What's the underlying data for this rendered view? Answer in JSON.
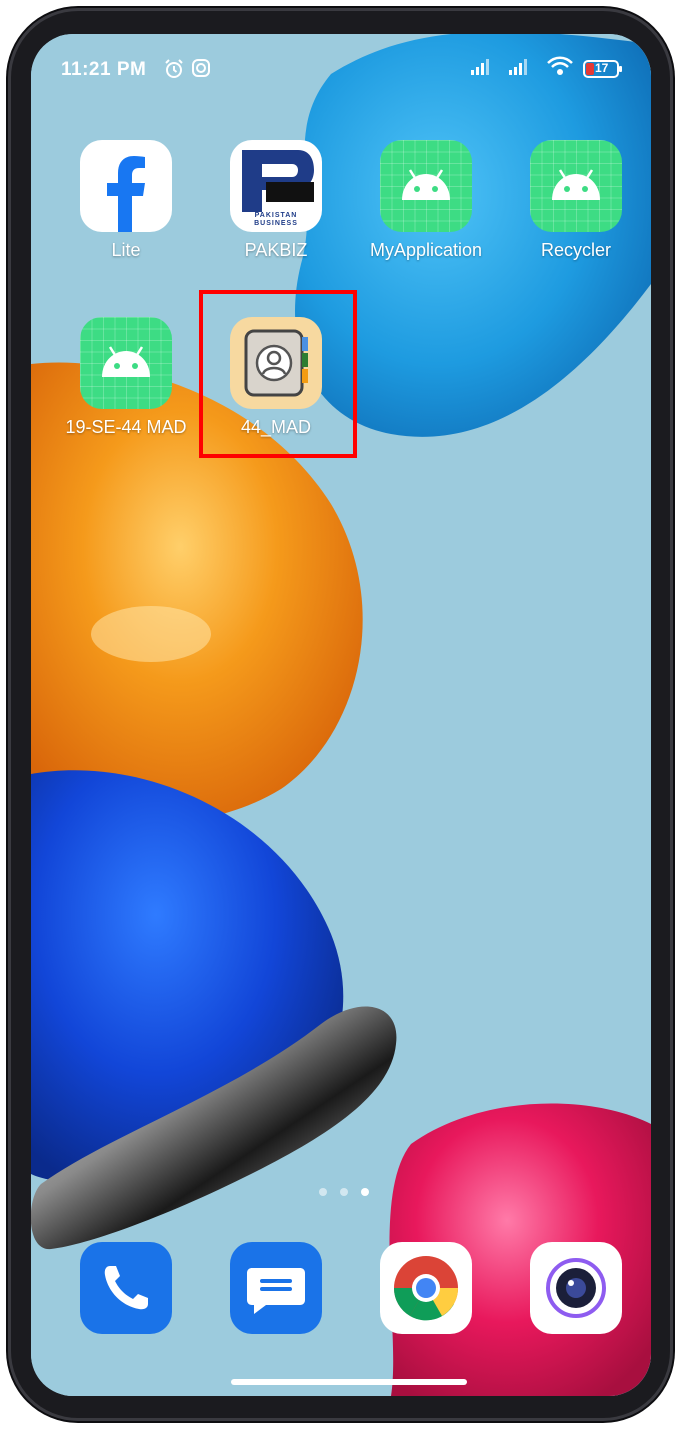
{
  "status_bar": {
    "time": "11:21 PM",
    "battery": "17",
    "icons": [
      "alarm-icon",
      "instagram-icon",
      "signal-icon",
      "signal-icon",
      "wifi-icon",
      "battery-icon"
    ]
  },
  "apps": [
    {
      "label": "Lite",
      "icon": "facebook-lite-icon"
    },
    {
      "label": "PAKBIZ",
      "icon": "pakbiz-icon",
      "logo_text": "PAKISTAN BUSINESS"
    },
    {
      "label": "MyApplication",
      "icon": "android-icon"
    },
    {
      "label": "Recycler",
      "icon": "android-icon"
    },
    {
      "label": "19-SE-44 MAD",
      "icon": "android-icon"
    },
    {
      "label": "44_MAD",
      "icon": "contacts-icon",
      "highlighted": true
    }
  ],
  "page_indicator": {
    "pages": 3,
    "active": 3
  },
  "dock": [
    {
      "name": "phone",
      "icon": "phone-icon"
    },
    {
      "name": "messages",
      "icon": "messages-icon"
    },
    {
      "name": "chrome",
      "icon": "chrome-icon"
    },
    {
      "name": "camera",
      "icon": "camera-icon"
    }
  ],
  "colors": {
    "highlight": "#ff0000",
    "android_green": "#3ddc84",
    "wallpaper_bg": "#9ccbdd"
  }
}
